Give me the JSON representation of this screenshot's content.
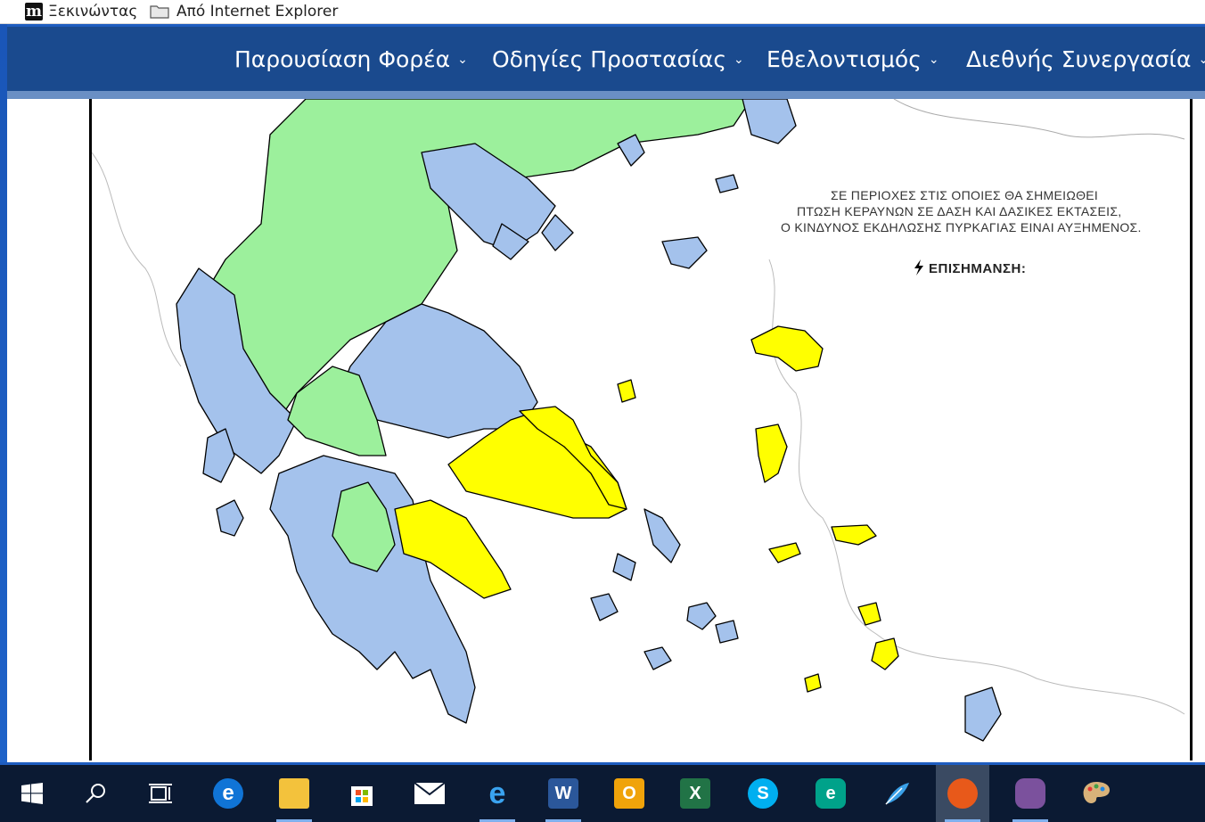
{
  "bookmarks": [
    {
      "label": "Ξεκινώντας",
      "icon": "m-logo-icon"
    },
    {
      "label": "Από Internet Explorer",
      "icon": "folder-icon"
    }
  ],
  "nav": {
    "items": [
      {
        "label": "Παρουσίαση Φορέα",
        "icon": "chevron-down-icon"
      },
      {
        "label": "Οδηγίες Προστασίας",
        "icon": "chevron-down-icon"
      },
      {
        "label": "Εθελοντισμός",
        "icon": "chevron-down-icon"
      },
      {
        "label": "Διεθνής Συνεργασία",
        "icon": "chevron-down-icon"
      }
    ]
  },
  "map": {
    "note_title": "ΕΠΙΣΗΜΑΝΣΗ:",
    "note_lines": [
      "ΣΕ ΠΕΡΙΟΧΕΣ ΣΤΙΣ ΟΠΟΙΕΣ ΘΑ ΣΗΜΕΙΩΘΕΙ",
      "ΠΤΩΣΗ ΚΕΡΑΥΝΩΝ ΣΕ ΔΑΣΗ ΚΑΙ ΔΑΣΙΚΕΣ ΕΚΤΑΣΕΙΣ,",
      "Ο ΚΙΝΔΥΝΟΣ ΕΚΔΗΛΩΣΗΣ ΠΥΡΚΑΓΙΑΣ ΕΙΝΑΙ ΑΥΞΗΜΕΝΟΣ."
    ],
    "colors": {
      "green": "#9cf09c",
      "blue": "#a4c2ec",
      "yellow": "#ffff00"
    }
  },
  "taskbar": {
    "items": [
      "windows-start-icon",
      "search-icon",
      "task-view-icon",
      "edge-icon",
      "file-explorer-icon",
      "store-icon",
      "mail-icon",
      "internet-explorer-icon",
      "word-icon",
      "outlook-icon",
      "excel-icon",
      "skype-icon",
      "e-app-icon",
      "feather-app-icon",
      "firefox-icon",
      "viber-icon",
      "paint-icon"
    ]
  }
}
